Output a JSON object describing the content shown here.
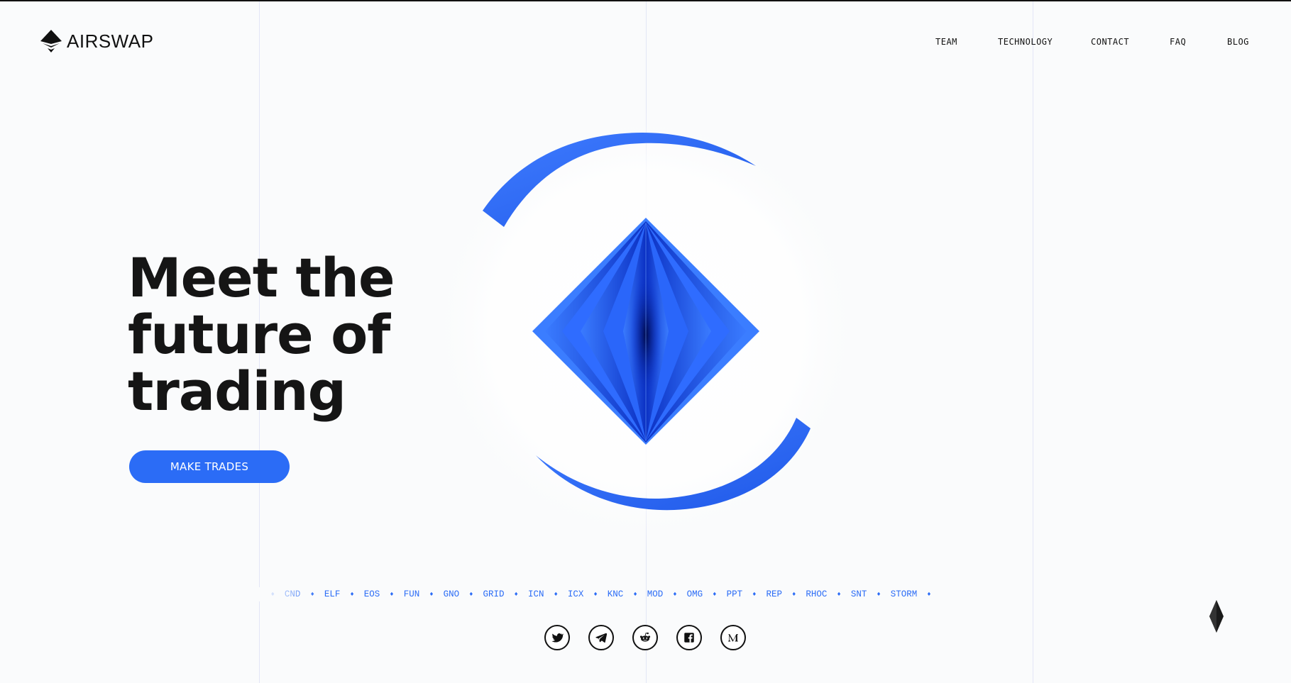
{
  "brand": {
    "name": "AIRSWAP",
    "logo_icon": "airswap-logo-icon"
  },
  "nav": {
    "items": [
      {
        "label": "TEAM"
      },
      {
        "label": "TECHNOLOGY"
      },
      {
        "label": "CONTACT"
      },
      {
        "label": "FAQ"
      },
      {
        "label": "BLOG"
      }
    ]
  },
  "hero": {
    "title_lines": [
      "Meet the",
      "future of",
      "trading"
    ],
    "cta_label": "MAKE TRADES"
  },
  "ticker": {
    "tokens": [
      "CND",
      "ELF",
      "EOS",
      "FUN",
      "GNO",
      "GRID",
      "ICN",
      "ICX",
      "KNC",
      "MOD",
      "OMG",
      "PPT",
      "REP",
      "RHOC",
      "SNT",
      "STORM"
    ],
    "leading_partial": "C"
  },
  "socials": [
    {
      "icon": "twitter-icon"
    },
    {
      "icon": "telegram-icon"
    },
    {
      "icon": "reddit-icon"
    },
    {
      "icon": "facebook-icon"
    },
    {
      "icon": "medium-icon"
    }
  ],
  "colors": {
    "accent": "#2b6cf6",
    "text": "#111111",
    "background": "#fafbfc"
  }
}
